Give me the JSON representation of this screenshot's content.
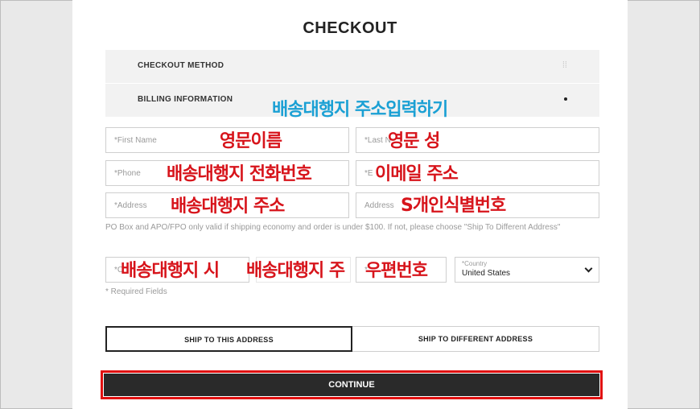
{
  "page": {
    "title": "CHECKOUT"
  },
  "sections": {
    "method_label": "CHECKOUT METHOD",
    "billing_label": "BILLING INFORMATION",
    "method_icon": "expand-toggle-icon",
    "billing_icon": "active-dot-icon"
  },
  "fields": {
    "first_name_placeholder": "*First Name",
    "last_name_placeholder": "*Last N",
    "phone_placeholder": "*Phone",
    "email_placeholder": "*E",
    "address_placeholder": "*Address",
    "address2_placeholder": "Address",
    "city_placeholder": "*C",
    "zip_placeholder": "*",
    "country_label": "*Country",
    "country_value": "United States"
  },
  "notes": {
    "po_box": "PO Box and APO/FPO only valid if shipping economy and order is under $100. If not, please choose \"Ship To Different Address\"",
    "required": "* Required Fields"
  },
  "annotations": {
    "billing": "배송대행지 주소입력하기",
    "first_name": "영문이름",
    "last_name": "영문 성",
    "phone": "배송대행지 전화번호",
    "email": "이메일 주소",
    "address": "배송대행지 주소",
    "address2": "S개인식별번호",
    "city": "배송대행지 시",
    "state": "배송대행지 주",
    "zip": "우편번호"
  },
  "buttons": {
    "ship_this": "SHIP TO THIS ADDRESS",
    "ship_different": "SHIP TO DIFFERENT ADDRESS",
    "continue": "CONTINUE"
  },
  "colors": {
    "annotation_red": "#d7141b",
    "annotation_blue": "#1aa0d4",
    "continue_bg": "#2a2a2a",
    "highlight_outline": "#e01010"
  }
}
